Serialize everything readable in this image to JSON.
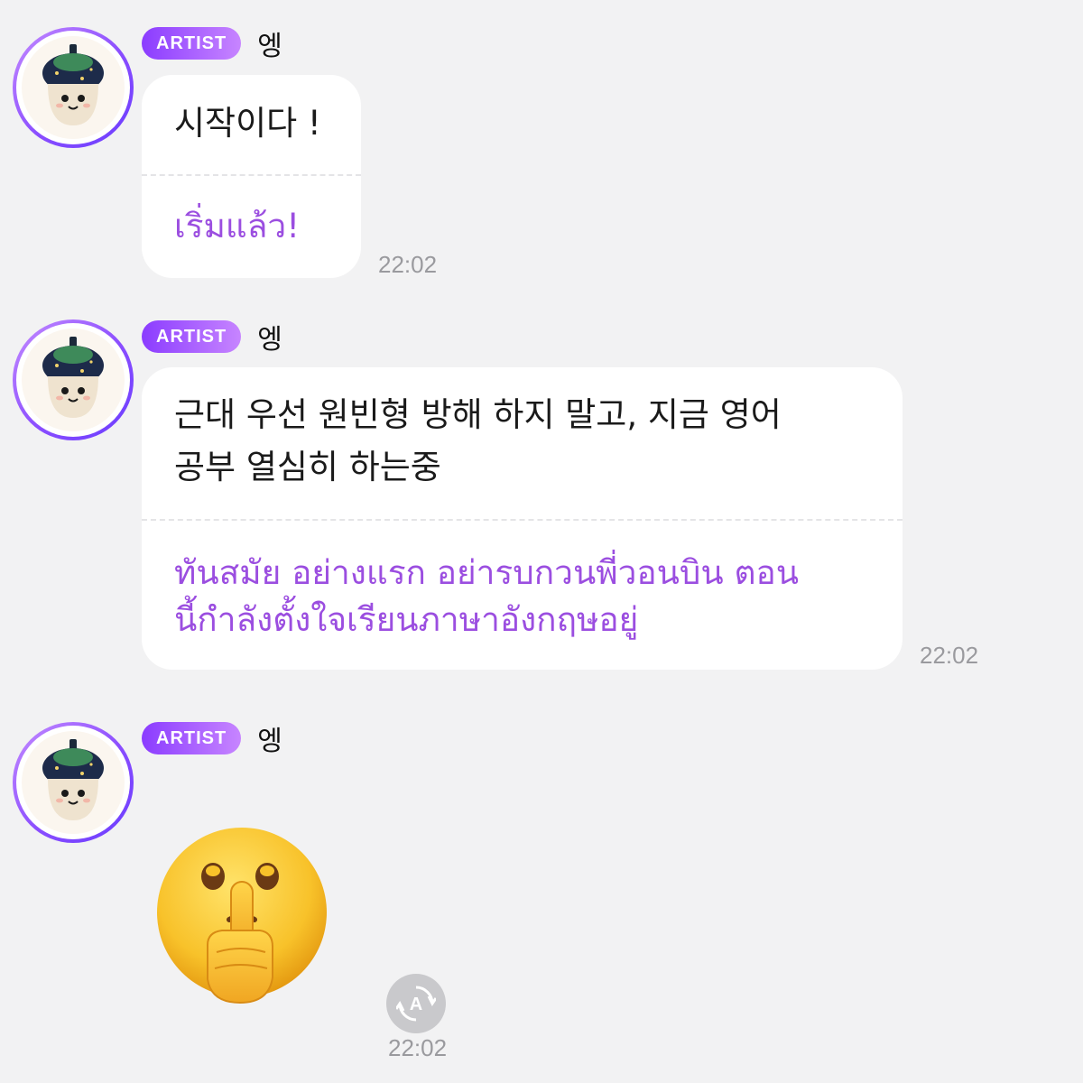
{
  "messages": [
    {
      "badge": "ARTIST",
      "sender": "엥",
      "original": [
        "시작이다 !"
      ],
      "translated": [
        "เริ่มแล้ว!"
      ],
      "time": "22:02"
    },
    {
      "badge": "ARTIST",
      "sender": "엥",
      "original": [
        "근대 우선 원빈형 방해 하지 말고, 지금 영어",
        "공부 열심히 하는중"
      ],
      "translated": [
        "ทันสมัย อย่างแรก อย่ารบกวนพี่วอนบิน ตอน",
        "นี้กำลังตั้งใจเรียนภาษาอังกฤษอยู่"
      ],
      "time": "22:02"
    },
    {
      "badge": "ARTIST",
      "sender": "엥",
      "emoji": "shushing-face",
      "time": "22:02"
    }
  ],
  "colors": {
    "background": "#f2f2f3",
    "badge_gradient_start": "#8b3cff",
    "badge_gradient_end": "#c785ff",
    "translation_text": "#9b4ee0",
    "timestamp": "#9a9a9e"
  },
  "icons": {
    "avatar": "mushroom-doll-avatar",
    "translate": "auto-translate-icon"
  }
}
